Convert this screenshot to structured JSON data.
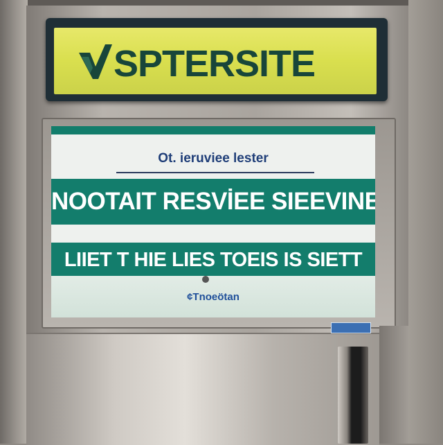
{
  "sign": {
    "title": "SPTERSITE",
    "logo_icon": "chevron-logo-icon",
    "colors": {
      "panel": "#d9df4e",
      "text": "#18463a",
      "frame": "#1f2e36"
    }
  },
  "display": {
    "subtitle": "Ot. ieruviee lester",
    "band_1": "NOOTAIT RESVİEE SIEEVINED.",
    "band_2": "LIIET T HIE LIES TOEIS IS SIETT",
    "footer": "¢Tnoeötan",
    "colors": {
      "band": "#137d6c",
      "background": "#eef1ee",
      "subtitle": "#1f3e78"
    }
  },
  "door": {
    "handle_icon": "door-handle-icon",
    "label_plate_icon": "label-plate-icon"
  }
}
